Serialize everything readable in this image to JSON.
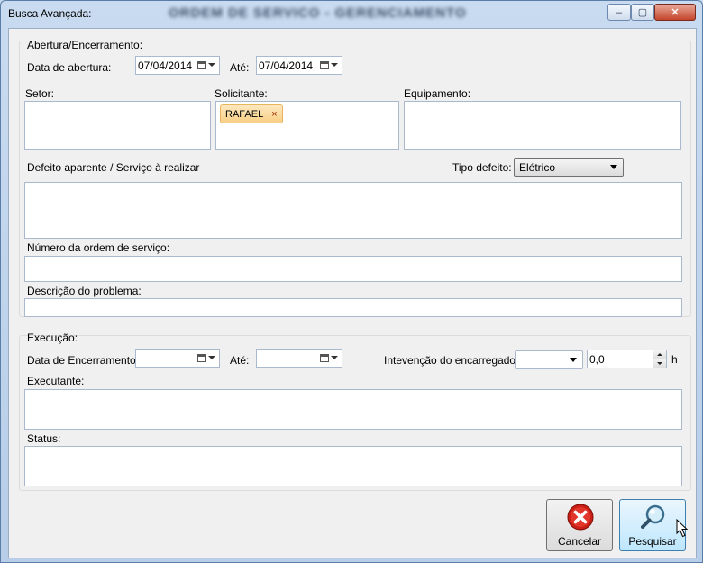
{
  "window": {
    "title": "Busca Avançada:",
    "blurred_title": "ORDEM DE SERVICO - GERENCIAMENTO",
    "minimize_glyph": "–",
    "maximize_glyph": "▢",
    "close_glyph": "✕"
  },
  "abertura": {
    "group_title": "Abertura/Encerramento:",
    "data_label": "Data de abertura:",
    "data_value": "07/04/2014",
    "ate_label": "Até:",
    "ate_value": "07/04/2014",
    "setor_label": "Setor:",
    "solicitante_label": "Solicitante:",
    "solicitante_chip": "RAFAEL",
    "chip_remove": "×",
    "equipamento_label": "Equipamento:",
    "defeito_label": "Defeito aparente / Serviço à realizar",
    "tipo_label": "Tipo defeito:",
    "tipo_value": "Elétrico",
    "numero_label": "Número da ordem de serviço:",
    "descricao_label": "Descrição do problema:"
  },
  "execucao": {
    "group_title": "Execução:",
    "data_label": "Data de Encerramento:",
    "data_value": "",
    "ate_label": "Até:",
    "ate_value": "",
    "intervencao_label": "Intevenção do encarregado:",
    "intervencao_value": "",
    "hours_value": "0,0",
    "hours_unit": "h",
    "executante_label": "Executante:",
    "status_label": "Status:"
  },
  "buttons": {
    "cancel_label": "Cancelar",
    "search_label": "Pesquisar"
  },
  "icons": {
    "cancel": "red-x-circle-icon",
    "search": "magnifier-icon",
    "date": "calendar-icon"
  }
}
